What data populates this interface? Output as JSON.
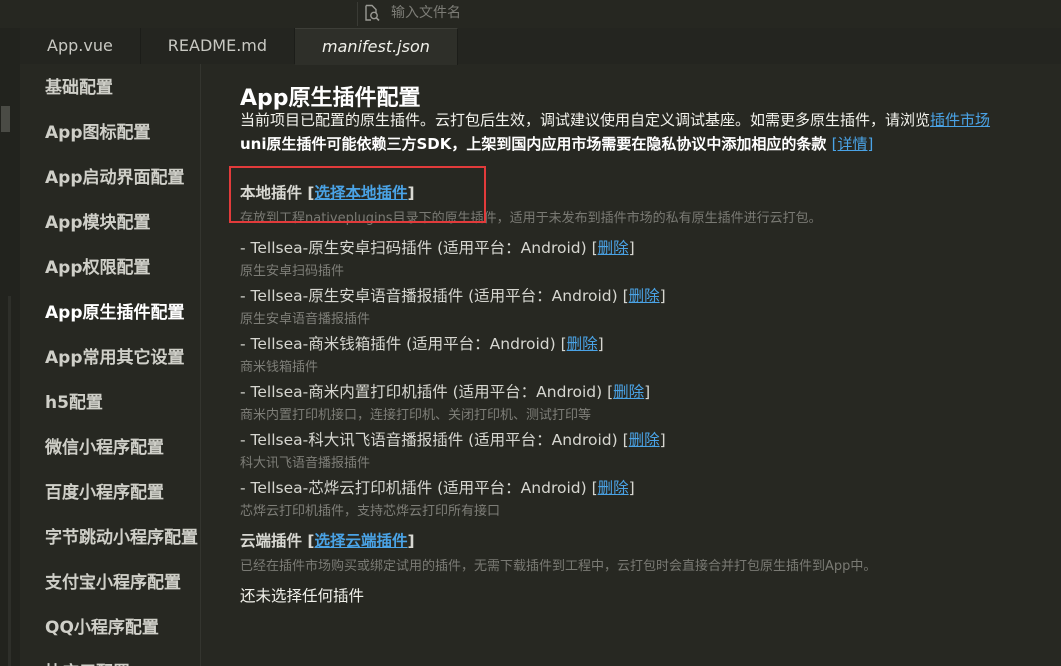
{
  "search": {
    "placeholder": "输入文件名"
  },
  "tabs": [
    {
      "label": "App.vue"
    },
    {
      "label": "README.md"
    },
    {
      "label": "manifest.json"
    }
  ],
  "nav": {
    "items": [
      {
        "label": "基础配置"
      },
      {
        "label": "App图标配置"
      },
      {
        "label": "App启动界面配置"
      },
      {
        "label": "App模块配置"
      },
      {
        "label": "App权限配置"
      },
      {
        "label": "App原生插件配置"
      },
      {
        "label": "App常用其它设置"
      },
      {
        "label": "h5配置"
      },
      {
        "label": "微信小程序配置"
      },
      {
        "label": "百度小程序配置"
      },
      {
        "label": "字节跳动小程序配置"
      },
      {
        "label": "支付宝小程序配置"
      },
      {
        "label": "QQ小程序配置"
      },
      {
        "label": "快应用配置"
      }
    ],
    "active_index": 5
  },
  "content": {
    "title": "App原生插件配置",
    "intro_line1": "当前项目已配置的原生插件。云打包后生效，调试建议使用自定义调试基座。如需更多原生插件，请浏览",
    "intro_link1": "插件市场",
    "intro_line2": "uni原生插件可能依赖三方SDK，上架到国内应用市场需要在隐私协议中添加相应的条款",
    "intro_link2": "[详情]",
    "local": {
      "title": "本地插件",
      "bracket_open": " [",
      "link": "选择本地插件",
      "bracket_close": "]",
      "desc": "存放到工程nativeplugins目录下的原生插件，适用于未发布到插件市场的私有原生插件进行云打包。"
    },
    "plugins": [
      {
        "name": "- Tellsea-原生安卓扫码插件 (适用平台：Android)",
        "delete": "删除",
        "desc": "原生安卓扫码插件"
      },
      {
        "name": "- Tellsea-原生安卓语音播报插件 (适用平台：Android)",
        "delete": "删除",
        "desc": "原生安卓语音播报插件"
      },
      {
        "name": "- Tellsea-商米钱箱插件 (适用平台：Android)",
        "delete": "删除",
        "desc": "商米钱箱插件"
      },
      {
        "name": "- Tellsea-商米内置打印机插件 (适用平台：Android)",
        "delete": "删除",
        "desc": "商米内置打印机接口，连接打印机、关闭打印机、测试打印等"
      },
      {
        "name": "- Tellsea-科大讯飞语音播报插件 (适用平台：Android)",
        "delete": "删除",
        "desc": "科大讯飞语音播报插件"
      },
      {
        "name": "- Tellsea-芯烨云打印机插件 (适用平台：Android)",
        "delete": "删除",
        "desc": "芯烨云打印机插件，支持芯烨云打印所有接口"
      }
    ],
    "cloud": {
      "title": "云端插件",
      "bracket_open": " [",
      "link": "选择云端插件",
      "bracket_close": "]",
      "desc": "已经在插件市场购买或绑定试用的插件，无需下载插件到工程中，云打包时会直接合并打包原生插件到App中。"
    },
    "empty_text": "还未选择任何插件"
  },
  "colors": {
    "link": "#4aa3e6",
    "highlight": "#e23b3b",
    "background": "#272822"
  },
  "icons": {
    "search": "file-search-icon"
  }
}
